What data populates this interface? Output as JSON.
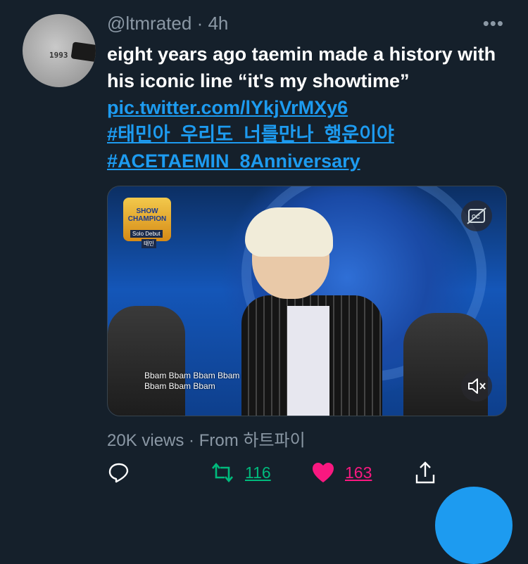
{
  "tweet": {
    "author_handle": "@ltmrated",
    "separator": "·",
    "time": "4h",
    "more_label": "•••",
    "avatar_text": "1993",
    "text": "eight years ago taemin made a history with his iconic line “it's my showtime”",
    "links": [
      "pic.twitter.com/lYkjVrMXy6",
      "#태민아_우리도_너를만나_행운이야",
      "#ACETAEMIN_8Anniversary"
    ],
    "media": {
      "logo_text": "SHOW CHAMPION",
      "logo_sub1": "Solo Debut",
      "logo_sub2": "태민",
      "caption_line1": "Bbam Bbam Bbam Bbam",
      "caption_line2": "Bbam Bbam Bbam",
      "cc_icon": "closed-captions-icon",
      "mute_icon": "muted-speaker-icon"
    },
    "views_text": "20K views · From 하트파이",
    "retweet_count": "116",
    "like_count": "163"
  },
  "colors": {
    "background": "#15202b",
    "link": "#1d9bf0",
    "retweet": "#00ba7c",
    "like": "#f91880",
    "muted": "#8b98a5"
  }
}
